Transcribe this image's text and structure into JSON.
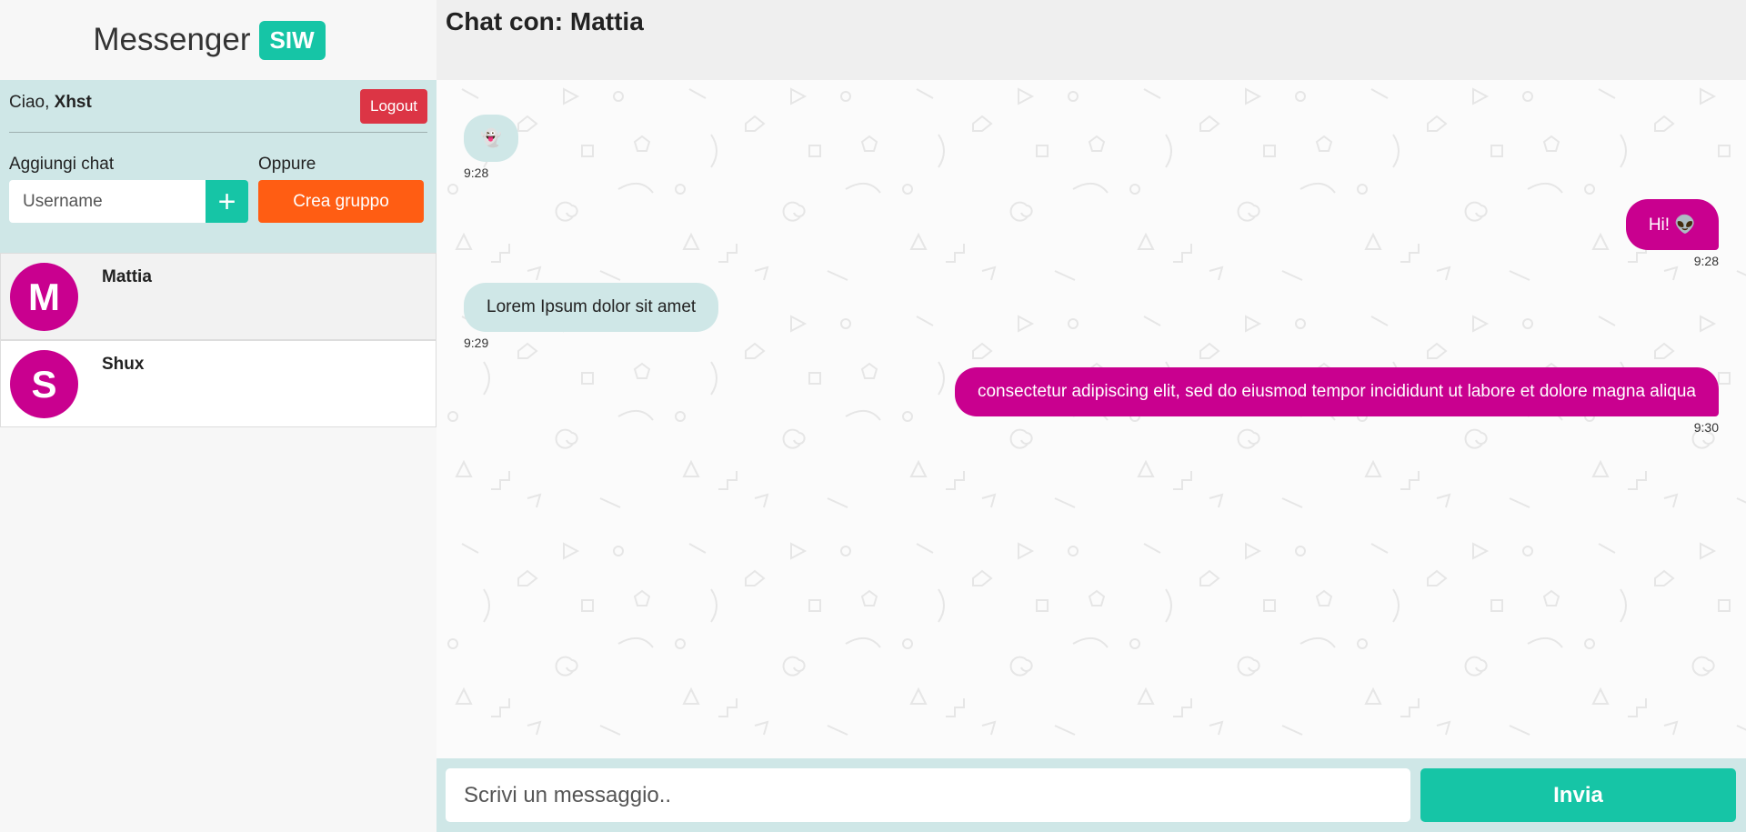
{
  "brand": {
    "name": "Messenger",
    "badge": "SIW"
  },
  "user": {
    "greeting": "Ciao,",
    "username": "Xhst",
    "logout_label": "Logout"
  },
  "add_chat": {
    "label": "Aggiungi chat",
    "placeholder": "Username",
    "add_button": "+",
    "or_label": "Oppure",
    "create_group_label": "Crea gruppo"
  },
  "contacts": [
    {
      "initial": "M",
      "name": "Mattia"
    },
    {
      "initial": "S",
      "name": "Shux"
    }
  ],
  "chat": {
    "title_prefix": "Chat con:",
    "title_name": "Mattia",
    "messages": [
      {
        "direction": "in",
        "text": "👻",
        "time": "9:28"
      },
      {
        "direction": "out",
        "text": "Hi! 👽",
        "time": "9:28"
      },
      {
        "direction": "in",
        "text": "Lorem Ipsum dolor sit amet",
        "time": "9:29"
      },
      {
        "direction": "out",
        "text": "consectetur adipiscing elit, sed do eiusmod tempor incididunt ut labore et dolore magna aliqua",
        "time": "9:30"
      }
    ]
  },
  "composer": {
    "placeholder": "Scrivi un messaggio..",
    "send_label": "Invia"
  },
  "colors": {
    "accent": "#16c5a6",
    "outgoing": "#c9008f",
    "incoming": "#cfe7e7",
    "logout": "#dc3545",
    "group": "#ff5d13"
  }
}
